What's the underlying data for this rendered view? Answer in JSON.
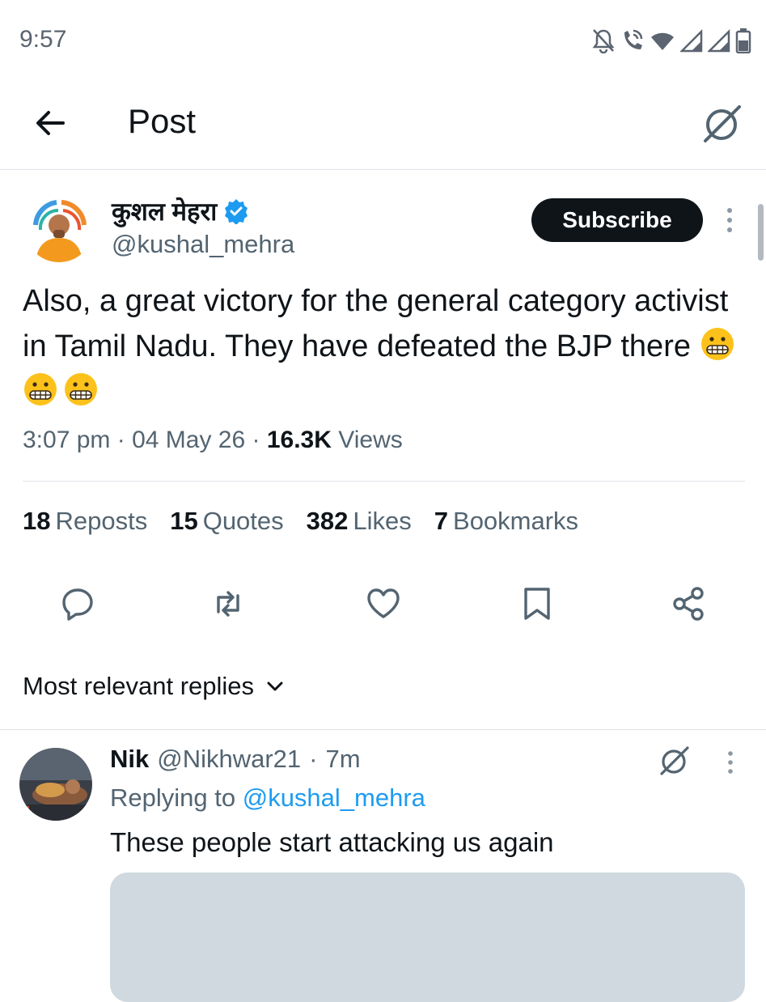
{
  "status_bar": {
    "time": "9:57",
    "icons": [
      "bell-off-icon",
      "wifi-call-icon",
      "wifi-icon",
      "signal-icon",
      "signal-icon",
      "battery-icon"
    ]
  },
  "header": {
    "title": "Post",
    "back_icon": "arrow-left-icon",
    "grok_icon": "grok-icon"
  },
  "post": {
    "author_name": "कुशल मेहरा",
    "verified": true,
    "handle": "@kushal_mehra",
    "subscribe_label": "Subscribe",
    "text": "Also, a great victory for the general category activist in Tamil Nadu. They have defeated the BJP there",
    "emojis": [
      "grimacing-face",
      "grimacing-face",
      "grimacing-face"
    ],
    "time": "3:07 pm",
    "date": "04 May 26",
    "views_count": "16.3K",
    "views_label": "Views",
    "stats": [
      {
        "count": "18",
        "label": "Reposts"
      },
      {
        "count": "15",
        "label": "Quotes"
      },
      {
        "count": "382",
        "label": "Likes"
      },
      {
        "count": "7",
        "label": "Bookmarks"
      }
    ],
    "actions": [
      "reply-icon",
      "retweet-icon",
      "like-icon",
      "bookmark-icon",
      "share-icon"
    ]
  },
  "replies": {
    "sort_label": "Most relevant replies",
    "items": [
      {
        "name": "Nik",
        "handle": "@Nikhwar21",
        "time": "7m",
        "replying_prefix": "Replying to",
        "replying_to": "@kushal_mehra",
        "text": "These people start attacking us again"
      }
    ]
  },
  "colors": {
    "text": "#0f1419",
    "secondary": "#536471",
    "accent": "#1d9bf0",
    "button_bg": "#0f1419",
    "divider": "#dfe3e7"
  }
}
